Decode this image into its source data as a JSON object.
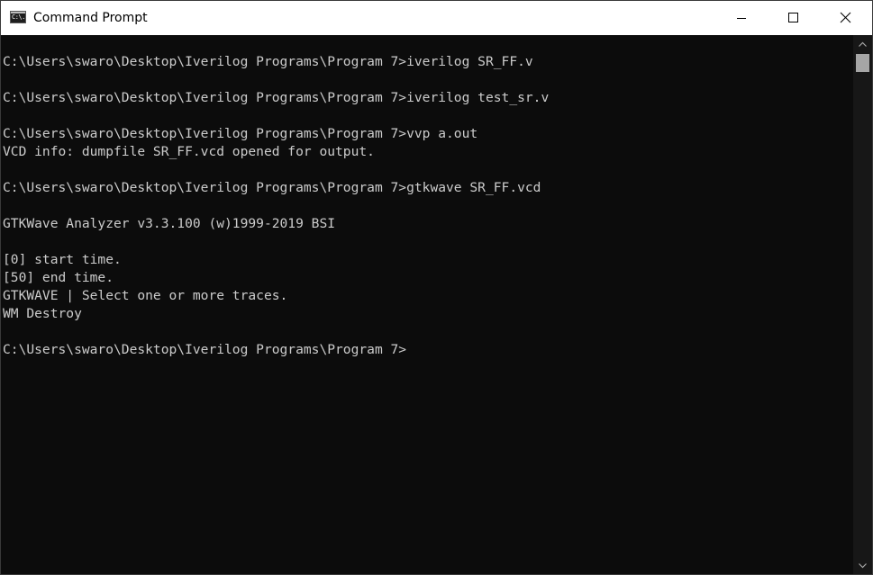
{
  "window": {
    "title": "Command Prompt",
    "icon_text": "C:\\."
  },
  "console": {
    "lines": [
      "C:\\Users\\swaro\\Desktop\\Iverilog Programs\\Program 7>iverilog SR_FF.v",
      "",
      "C:\\Users\\swaro\\Desktop\\Iverilog Programs\\Program 7>iverilog test_sr.v",
      "",
      "C:\\Users\\swaro\\Desktop\\Iverilog Programs\\Program 7>vvp a.out",
      "VCD info: dumpfile SR_FF.vcd opened for output.",
      "",
      "C:\\Users\\swaro\\Desktop\\Iverilog Programs\\Program 7>gtkwave SR_FF.vcd",
      "",
      "GTKWave Analyzer v3.3.100 (w)1999-2019 BSI",
      "",
      "[0] start time.",
      "[50] end time.",
      "GTKWAVE | Select one or more traces.",
      "WM Destroy",
      "",
      "C:\\Users\\swaro\\Desktop\\Iverilog Programs\\Program 7>"
    ]
  },
  "colors": {
    "titlebar_bg": "#ffffff",
    "console_bg": "#0c0c0c",
    "console_text": "#cccccc",
    "scrollbar_bg": "#171717",
    "scrollbar_thumb": "#a6a6a6"
  },
  "icons": {
    "minimize": "minimize-icon",
    "maximize": "maximize-icon",
    "close": "close-icon",
    "scroll_up": "chevron-up-icon",
    "scroll_down": "chevron-down-icon"
  }
}
